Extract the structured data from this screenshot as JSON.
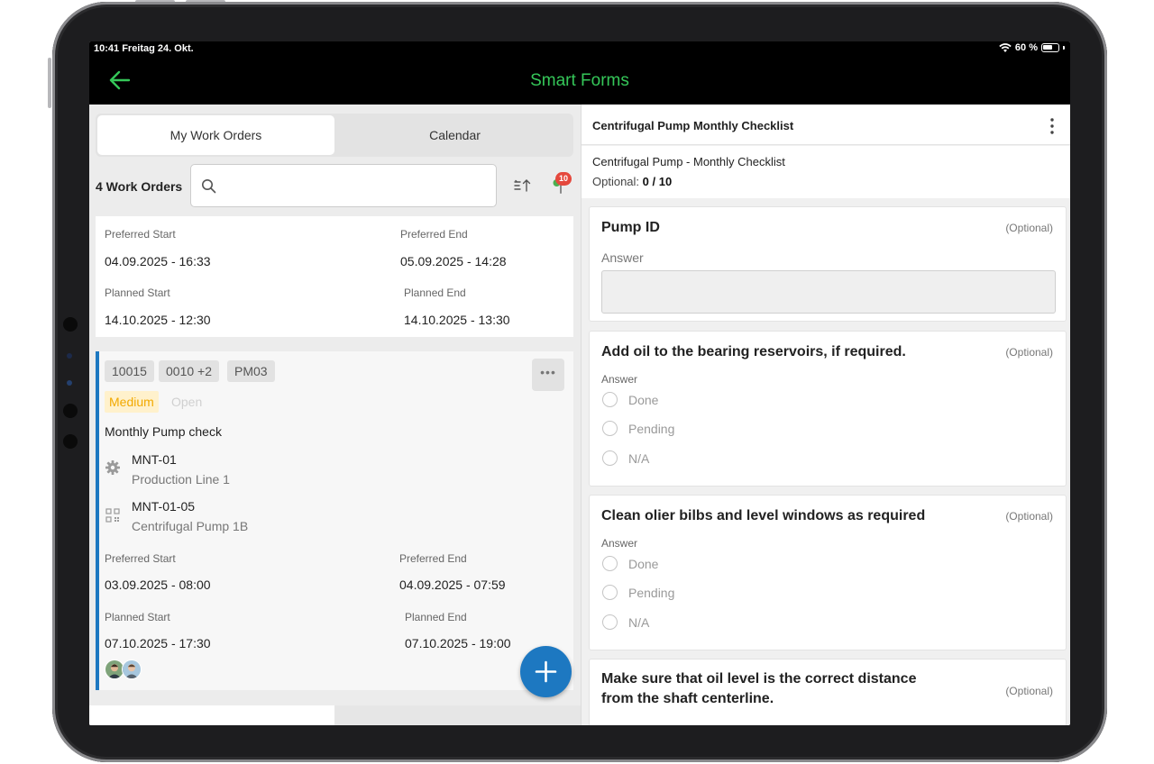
{
  "status_bar": {
    "time": "10:41  Freitag 24. Okt.",
    "battery": "60 %"
  },
  "header": {
    "title": "Smart Forms"
  },
  "left_pane": {
    "tabs": [
      {
        "label": "My Work Orders",
        "active": true
      },
      {
        "label": "Calendar",
        "active": false
      }
    ],
    "work_order_count": "4 Work Orders",
    "search": {
      "placeholder": ""
    },
    "map_badge": "10",
    "card1": {
      "preferred_start_label": "Preferred Start",
      "preferred_start": "04.09.2025 - 16:33",
      "preferred_end_label": "Preferred End",
      "preferred_end": "05.09.2025 - 14:28",
      "planned_start_label": "Planned Start",
      "planned_start": "14.10.2025 - 12:30",
      "planned_end_label": "Planned End",
      "planned_end": "14.10.2025 - 13:30"
    },
    "card2": {
      "chips": [
        "10015",
        "0010 +2",
        "PM03"
      ],
      "more": "•••",
      "priority": "Medium",
      "status": "Open",
      "description": "Monthly Pump check",
      "functional_location": {
        "id": "MNT-01",
        "name": "Production Line 1",
        "icon": "gear-icon"
      },
      "equipment": {
        "id": "MNT-01-05",
        "name": "Centrifugal Pump 1B",
        "icon": "qr-code-icon"
      },
      "preferred_start_label": "Preferred Start",
      "preferred_start": "03.09.2025 - 08:00",
      "preferred_end_label": "Preferred End",
      "preferred_end": "04.09.2025 - 07:59",
      "planned_start_label": "Planned Start",
      "planned_start": "07.10.2025 - 17:30",
      "planned_end_label": "Planned End",
      "planned_end": "07.10.2025 - 19:00"
    }
  },
  "right_pane": {
    "form_header": "Centrifugal Pump Monthly Checklist",
    "form_name": "Centrifugal Pump - Monthly Checklist",
    "optional_label": "Optional:",
    "optional_value": "0 / 10",
    "questions": [
      {
        "title": "Pump ID",
        "optional": "(Optional)",
        "answer_label": "Answer",
        "type": "text"
      },
      {
        "title": "Add oil to the bearing reservoirs, if required.",
        "optional": "(Optional)",
        "answer_label": "Answer",
        "options": [
          "Done",
          "Pending",
          "N/A"
        ]
      },
      {
        "title": "Clean olier bilbs and level windows as required",
        "optional": "(Optional)",
        "answer_label": "Answer",
        "options": [
          "Done",
          "Pending",
          "N/A"
        ]
      },
      {
        "title_line1": "Make sure that oil level is the correct distance",
        "title_line2": "from the shaft centerline.",
        "optional": "(Optional)"
      }
    ]
  },
  "colors": {
    "header_bg": "#000000",
    "accent_green": "#35c759",
    "primary_blue": "#1d78c1",
    "priority_yellow": "#f2a900",
    "badge_red": "#e5483d"
  }
}
